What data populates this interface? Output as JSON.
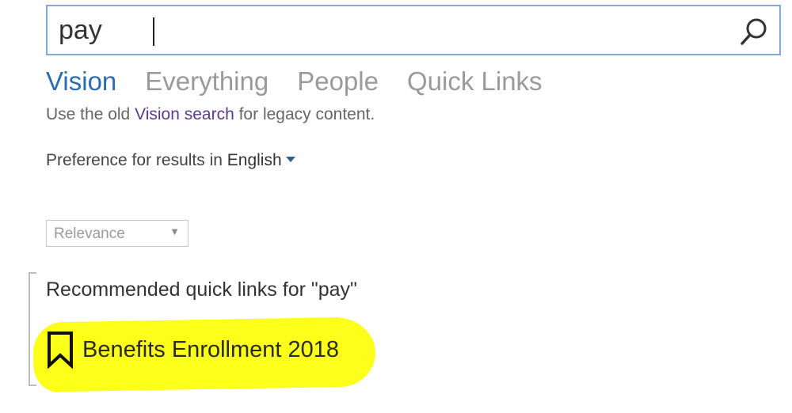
{
  "search": {
    "query": "pay",
    "icon": "search-icon"
  },
  "tabs": [
    {
      "label": "Vision",
      "active": true
    },
    {
      "label": "Everything",
      "active": false
    },
    {
      "label": "People",
      "active": false
    },
    {
      "label": "Quick Links",
      "active": false
    }
  ],
  "legacy": {
    "prefix": "Use the old ",
    "link": "Vision search",
    "suffix": " for legacy content."
  },
  "preference": {
    "label": "Preference for results in ",
    "language": "English"
  },
  "sort": {
    "selected": "Relevance",
    "arrow": "▼"
  },
  "recommended": {
    "heading": "Recommended quick links for \"pay\"",
    "items": [
      {
        "label": "Benefits Enrollment 2018",
        "icon": "bookmark-icon",
        "highlight_color": "#fcff1a"
      }
    ]
  },
  "colors": {
    "accent": "#2b6cb0",
    "link": "#5a3d8a",
    "inactive_tab": "#9a9a9a",
    "search_border": "#7fa9d6"
  }
}
